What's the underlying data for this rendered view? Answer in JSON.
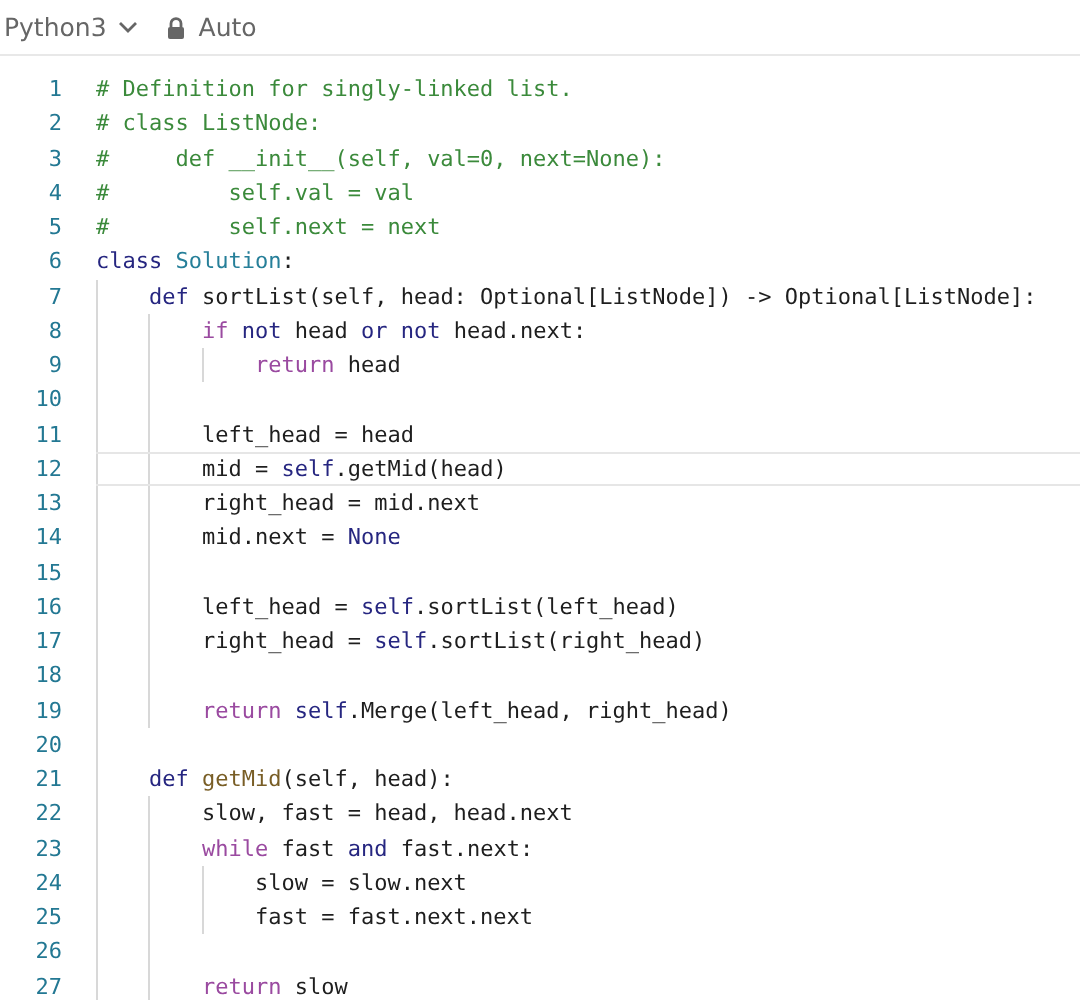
{
  "toolbar": {
    "language": "Python3",
    "mode": "Auto"
  },
  "editor": {
    "lines": [
      {
        "number": "1",
        "current": false,
        "tokens": [
          {
            "kind": "comment",
            "text": "# Definition for singly-linked list."
          }
        ]
      },
      {
        "number": "2",
        "current": false,
        "tokens": [
          {
            "kind": "comment",
            "text": "# class ListNode:"
          }
        ]
      },
      {
        "number": "3",
        "current": false,
        "tokens": [
          {
            "kind": "comment",
            "text": "#     def __init__(self, val=0, next=None):"
          }
        ]
      },
      {
        "number": "4",
        "current": false,
        "tokens": [
          {
            "kind": "comment",
            "text": "#         self.val = val"
          }
        ]
      },
      {
        "number": "5",
        "current": false,
        "tokens": [
          {
            "kind": "comment",
            "text": "#         self.next = next"
          }
        ]
      },
      {
        "number": "6",
        "current": false,
        "tokens": [
          {
            "kind": "keyword",
            "text": "class"
          },
          {
            "kind": "type",
            "text": " Solution"
          },
          {
            "kind": "plain",
            "text": ":"
          }
        ]
      },
      {
        "number": "7",
        "current": false,
        "tokens": [
          {
            "kind": "keyword",
            "text": "    def"
          },
          {
            "kind": "plain",
            "text": " sortList(self, head: Optional[ListNode]) -> Optional[ListNode]:"
          }
        ]
      },
      {
        "number": "8",
        "current": false,
        "tokens": [
          {
            "kind": "control",
            "text": "        if"
          },
          {
            "kind": "keyword",
            "text": " not"
          },
          {
            "kind": "plain",
            "text": " head "
          },
          {
            "kind": "keyword",
            "text": "or not"
          },
          {
            "kind": "plain",
            "text": " head.next:"
          }
        ]
      },
      {
        "number": "9",
        "current": false,
        "tokens": [
          {
            "kind": "control",
            "text": "            return"
          },
          {
            "kind": "plain",
            "text": " head"
          }
        ]
      },
      {
        "number": "10",
        "current": false
      },
      {
        "number": "11",
        "current": false,
        "tokens": [
          {
            "kind": "plain",
            "text": "        left_head = head"
          }
        ]
      },
      {
        "number": "12",
        "current": true,
        "tokens": [
          {
            "kind": "plain",
            "text": "        mid = "
          },
          {
            "kind": "keyword",
            "text": "self"
          },
          {
            "kind": "plain",
            "text": ".getMid(head)"
          }
        ]
      },
      {
        "number": "13",
        "current": false,
        "tokens": [
          {
            "kind": "plain",
            "text": "        right_head = mid.next"
          }
        ]
      },
      {
        "number": "14",
        "current": false,
        "tokens": [
          {
            "kind": "plain",
            "text": "        mid.next = "
          },
          {
            "kind": "keyword",
            "text": "None"
          }
        ]
      },
      {
        "number": "15",
        "current": false
      },
      {
        "number": "16",
        "current": false,
        "tokens": [
          {
            "kind": "plain",
            "text": "        left_head = "
          },
          {
            "kind": "keyword",
            "text": "self"
          },
          {
            "kind": "plain",
            "text": ".sortList(left_head)"
          }
        ]
      },
      {
        "number": "17",
        "current": false,
        "tokens": [
          {
            "kind": "plain",
            "text": "        right_head = "
          },
          {
            "kind": "keyword",
            "text": "self"
          },
          {
            "kind": "plain",
            "text": ".sortList(right_head)"
          }
        ]
      },
      {
        "number": "18",
        "current": false
      },
      {
        "number": "19",
        "current": false,
        "tokens": [
          {
            "kind": "control",
            "text": "        return"
          },
          {
            "kind": "keyword",
            "text": " self"
          },
          {
            "kind": "plain",
            "text": ".Merge(left_head, right_head)"
          }
        ]
      },
      {
        "number": "20",
        "current": false
      },
      {
        "number": "21",
        "current": false,
        "tokens": [
          {
            "kind": "keyword",
            "text": "    def"
          },
          {
            "kind": "function",
            "text": " getMid"
          },
          {
            "kind": "plain",
            "text": "(self, head):"
          }
        ]
      },
      {
        "number": "22",
        "current": false,
        "tokens": [
          {
            "kind": "plain",
            "text": "        slow, fast = head, head.next"
          }
        ]
      },
      {
        "number": "23",
        "current": false,
        "tokens": [
          {
            "kind": "control",
            "text": "        while"
          },
          {
            "kind": "plain",
            "text": " fast "
          },
          {
            "kind": "keyword",
            "text": "and"
          },
          {
            "kind": "plain",
            "text": " fast.next:"
          }
        ]
      },
      {
        "number": "24",
        "current": false,
        "tokens": [
          {
            "kind": "plain",
            "text": "            slow = slow.next"
          }
        ]
      },
      {
        "number": "25",
        "current": false,
        "tokens": [
          {
            "kind": "plain",
            "text": "            fast = fast.next.next"
          }
        ]
      },
      {
        "number": "26",
        "current": false
      },
      {
        "number": "27",
        "current": false,
        "tokens": [
          {
            "kind": "control",
            "text": "        return"
          },
          {
            "kind": "plain",
            "text": " slow"
          }
        ]
      }
    ]
  }
}
